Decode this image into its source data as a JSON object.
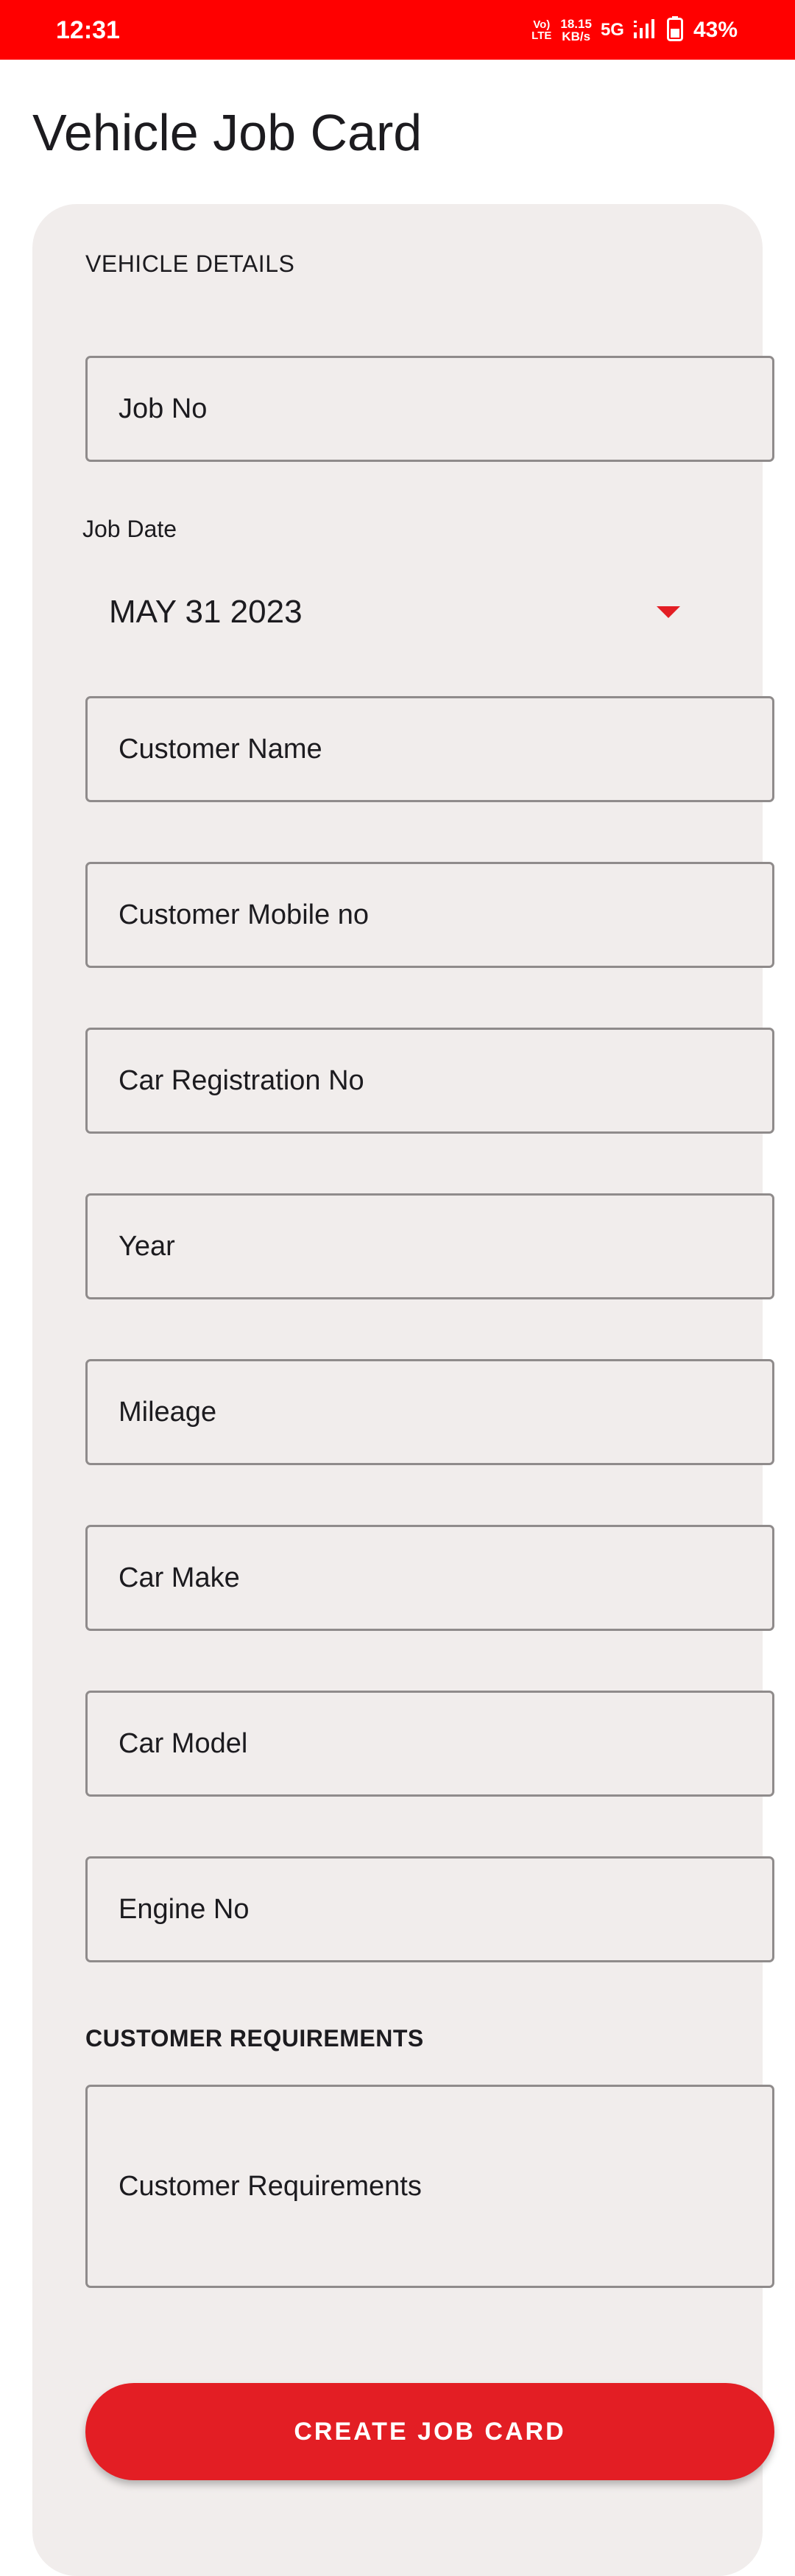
{
  "status_bar": {
    "time": "12:31",
    "volte_top": "Vo)",
    "volte_bottom": "LTE",
    "speed_value": "18.15",
    "speed_unit": "KB/s",
    "network": "5G",
    "battery": "43%",
    "background_color": "#ff0000"
  },
  "page": {
    "title": "Vehicle Job Card"
  },
  "vehicle_details": {
    "section_label": "VEHICLE DETAILS",
    "job_no_placeholder": "Job No",
    "job_date_label": "Job Date",
    "job_date_value": "MAY 31 2023",
    "customer_name_placeholder": "Customer Name",
    "customer_mobile_placeholder": "Customer Mobile no",
    "car_registration_placeholder": "Car Registration No",
    "year_placeholder": "Year",
    "mileage_placeholder": "Mileage",
    "car_make_placeholder": "Car Make",
    "car_model_placeholder": "Car Model",
    "engine_no_placeholder": "Engine No"
  },
  "customer_requirements": {
    "section_label": "CUSTOMER  REQUIREMENTS",
    "placeholder": "Customer Requirements"
  },
  "actions": {
    "create_label": "CREATE JOB CARD"
  },
  "colors": {
    "accent": "#e31e24",
    "card_background": "#f1edec",
    "field_border": "#8f8b8b"
  }
}
